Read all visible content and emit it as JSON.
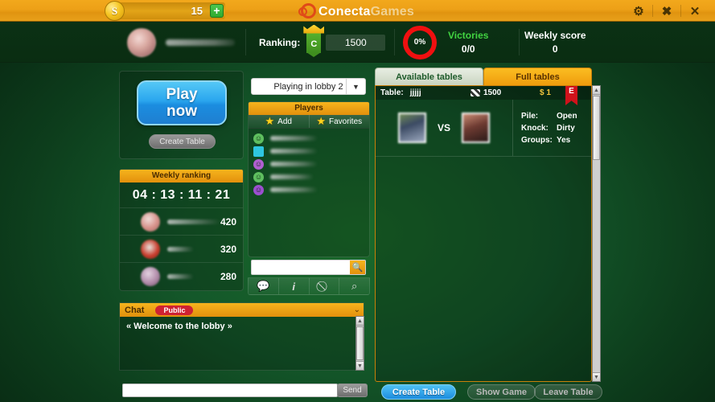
{
  "topbar": {
    "coin_icon": "coin-icon",
    "coin_symbol": "S",
    "coin_amount": "15",
    "plus_label": "+",
    "brand_first": "Conecta",
    "brand_second": "Games",
    "settings_icon": "⚙",
    "resize_icon": "✖",
    "close_icon": "✕"
  },
  "profile": {
    "ranking_label": "Ranking:",
    "rank_letter": "C",
    "rank_value": "1500",
    "percent": "0%",
    "victories_label": "Victories",
    "victories_value": "0/0",
    "weekly_label": "Weekly score",
    "weekly_value": "0"
  },
  "play": {
    "play_line1": "Play",
    "play_line2": "now",
    "create_table_label": "Create Table"
  },
  "weekly": {
    "header": "Weekly ranking",
    "timer": "04 : 13 : 11 : 21",
    "rows": [
      {
        "score": "420"
      },
      {
        "score": "320"
      },
      {
        "score": "280"
      }
    ]
  },
  "lobby": {
    "selected": "Playing in lobby 2",
    "caret": "▼"
  },
  "players": {
    "header": "Players",
    "add_label": "Add",
    "favorites_label": "Favorites",
    "star_icon": "★",
    "rows": [
      {
        "emoji": "☺"
      },
      {
        "emoji": "■"
      },
      {
        "emoji": "☺"
      },
      {
        "emoji": "☺"
      },
      {
        "emoji": "☺"
      }
    ],
    "search_value": "",
    "search_icon": "🔍",
    "tools": [
      {
        "icon": "💬",
        "name": "chat-icon"
      },
      {
        "icon": "i",
        "name": "info-icon"
      },
      {
        "icon": "⃠",
        "name": "block-icon"
      },
      {
        "icon": "⌕",
        "name": "add-search-icon"
      }
    ]
  },
  "tables": {
    "tab_available": "Available tables",
    "tab_full": "Full tables",
    "row": {
      "table_label": "Table:",
      "table_name": "jjjjj",
      "chips": "1500",
      "cost": "$ 1",
      "flag": "E",
      "vs": "VS",
      "info": [
        {
          "key": "Pile:",
          "value": "Open"
        },
        {
          "key": "Knock:",
          "value": "Dirty"
        },
        {
          "key": "Groups:",
          "value": "Yes"
        }
      ]
    }
  },
  "chat": {
    "title": "Chat",
    "pill": "Public",
    "caret": "⌄",
    "message": "« Welcome to the lobby »",
    "input_value": "",
    "send_label": "Send"
  },
  "bottom": {
    "create_table": "Create Table",
    "show_game": "Show Game",
    "leave_table": "Leave Table"
  }
}
